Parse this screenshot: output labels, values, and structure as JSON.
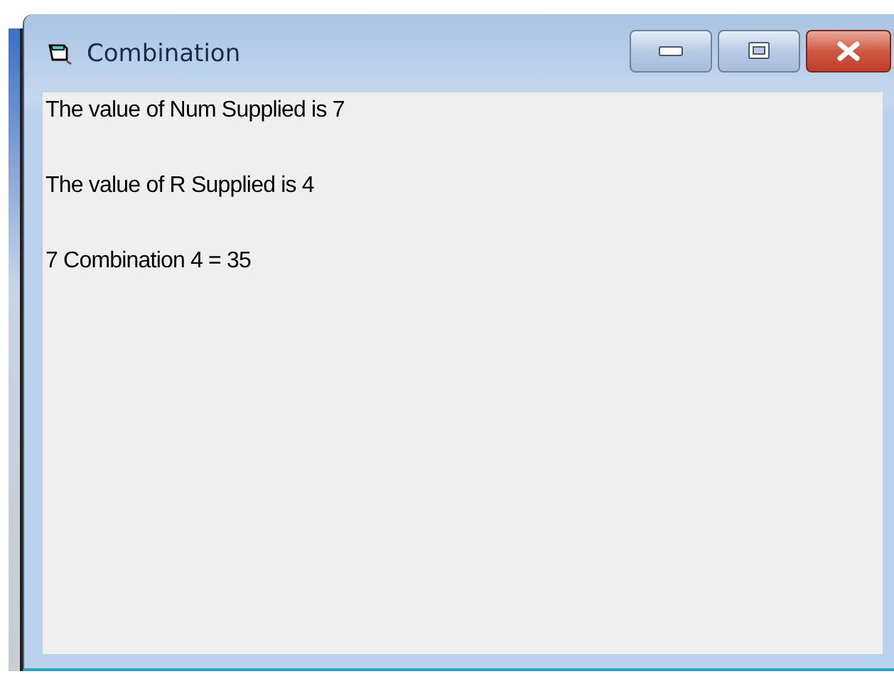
{
  "window": {
    "title": "Combination"
  },
  "lines": [
    "The value of Num Supplied is 7",
    "The value of R Supplied is 4",
    "7 Combination 4 = 35"
  ]
}
